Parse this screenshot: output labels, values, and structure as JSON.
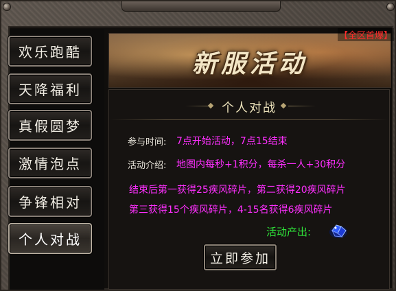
{
  "corner_tag": "【全区首爆】",
  "banner": {
    "title": "新服活动"
  },
  "sidebar": {
    "items": [
      {
        "label": "欢乐跑酷",
        "active": false
      },
      {
        "label": "天降福利",
        "active": false
      },
      {
        "label": "真假圆梦",
        "active": false
      },
      {
        "label": "激情泡点",
        "active": false
      },
      {
        "label": "争锋相对",
        "active": false
      },
      {
        "label": "个人对战",
        "active": true
      }
    ]
  },
  "panel": {
    "title": "个人对战",
    "time_label": "参与时间:",
    "time_text": "7点开始活动，7点15结束",
    "intro_label": "活动介绍:",
    "intro_text": "地图内每秒+1积分，每杀一人+30积分",
    "reward_line1": "结束后第一获得25疾风碎片，第二获得20疾风碎片",
    "reward_line2": "第三获得15个疾风碎片，4-15名获得6疾风碎片",
    "output_label": "活动产出:",
    "output_icon": "blue-gem-icon",
    "join_label": "立即参加"
  },
  "colors": {
    "highlight_text": "#ff2fff",
    "output_text": "#2fe63a",
    "tag_text": "#ff2b2b"
  }
}
